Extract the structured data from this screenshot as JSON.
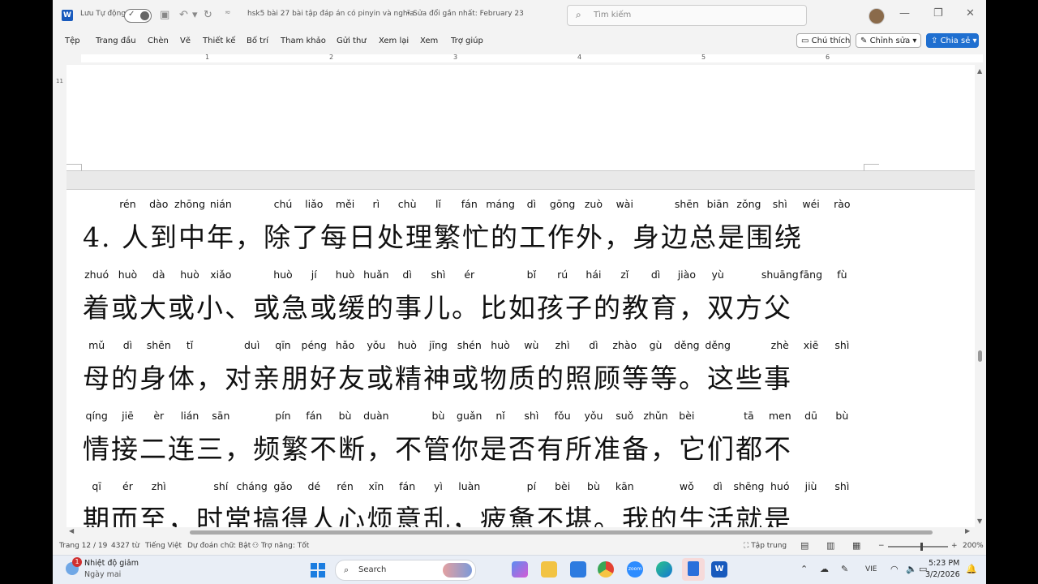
{
  "titlebar": {
    "autosave_label": "Lưu Tự động",
    "doc_title": "hsk5 bài 27 bài tập đáp án có pinyin và nghĩa",
    "modified": "• Sửa đổi gần nhất: February 23",
    "search_placeholder": "Tìm kiếm"
  },
  "menu": [
    "Tệp",
    "Trang đầu",
    "Chèn",
    "Vẽ",
    "Thiết kế",
    "Bố trí",
    "Tham khảo",
    "Gửi thư",
    "Xem lại",
    "Xem",
    "Trợ giúp"
  ],
  "actions": {
    "comment": "Chú thích",
    "edit": "Chỉnh sửa",
    "share": "Chia sẻ"
  },
  "ruler_numbers": [
    "1",
    "2",
    "3",
    "4",
    "5",
    "6"
  ],
  "vruler_number": "11",
  "document": {
    "lines": [
      {
        "text": "4. 人到中年，除了每日处理繁忙的工作外，身边总是围绕",
        "pinyin": [
          "rén",
          "dào",
          "zhōng",
          "nián",
          "chú",
          "liǎo",
          "měi",
          "rì",
          "chù",
          "lǐ",
          "fán",
          "máng",
          "dì",
          "gōng",
          "zuò",
          "wài",
          "shēn",
          "biān",
          "zǒng",
          "shì",
          "wéi",
          "rào"
        ]
      },
      {
        "text": "着或大或小、或急或缓的事儿。比如孩子的教育，双方父",
        "pinyin": [
          "zhuó",
          "huò",
          "dà",
          "huò",
          "xiǎo",
          "huò",
          "jí",
          "huò",
          "huǎn",
          "dì",
          "shì",
          "ér",
          "bǐ",
          "rú",
          "hái",
          "zǐ",
          "dì",
          "jiào",
          "yù",
          "shuāng",
          "fāng",
          "fù"
        ]
      },
      {
        "text": "母的身体，对亲朋好友或精神或物质的照顾等等。这些事",
        "pinyin": [
          "mǔ",
          "dì",
          "shēn",
          "tǐ",
          "duì",
          "qīn",
          "péng",
          "hǎo",
          "yǒu",
          "huò",
          "jīng",
          "shén",
          "huò",
          "wù",
          "zhì",
          "dì",
          "zhào",
          "gù",
          "děng",
          "děng",
          "zhè",
          "xiē",
          "shì"
        ]
      },
      {
        "text": "情接二连三，频繁不断，不管你是否有所准备，它们都不",
        "pinyin": [
          "qíng",
          "jiē",
          "èr",
          "lián",
          "sān",
          "pín",
          "fán",
          "bù",
          "duàn",
          "bù",
          "guǎn",
          "nǐ",
          "shì",
          "fǒu",
          "yǒu",
          "suǒ",
          "zhǔn",
          "bèi",
          "tā",
          "men",
          "dū",
          "bù"
        ]
      },
      {
        "text": "期而至，时常搞得人心烦意乱，疲惫不堪。我的生活就是",
        "pinyin": [
          "qī",
          "ér",
          "zhì",
          "shí",
          "cháng",
          "gǎo",
          "dé",
          "rén",
          "xīn",
          "fán",
          "yì",
          "luàn",
          "pí",
          "bèi",
          "bù",
          "kān",
          "wǒ",
          "dì",
          "shēng",
          "huó",
          "jiù",
          "shì"
        ]
      }
    ]
  },
  "status": {
    "page": "Trang 12 / 19",
    "words": "4327 từ",
    "language": "Tiếng Việt",
    "prediction": "Dự đoán chữ: Bật",
    "accessibility": "Trợ năng: Tốt",
    "focus": "Tập trung",
    "zoom": "200%"
  },
  "taskbar": {
    "weather_title": "Nhiệt độ giảm",
    "weather_sub": "Ngày mai",
    "notification_count": "1",
    "search": "Search",
    "lang": "VIE",
    "time": "5:23 PM",
    "date": "3/2/2026"
  }
}
